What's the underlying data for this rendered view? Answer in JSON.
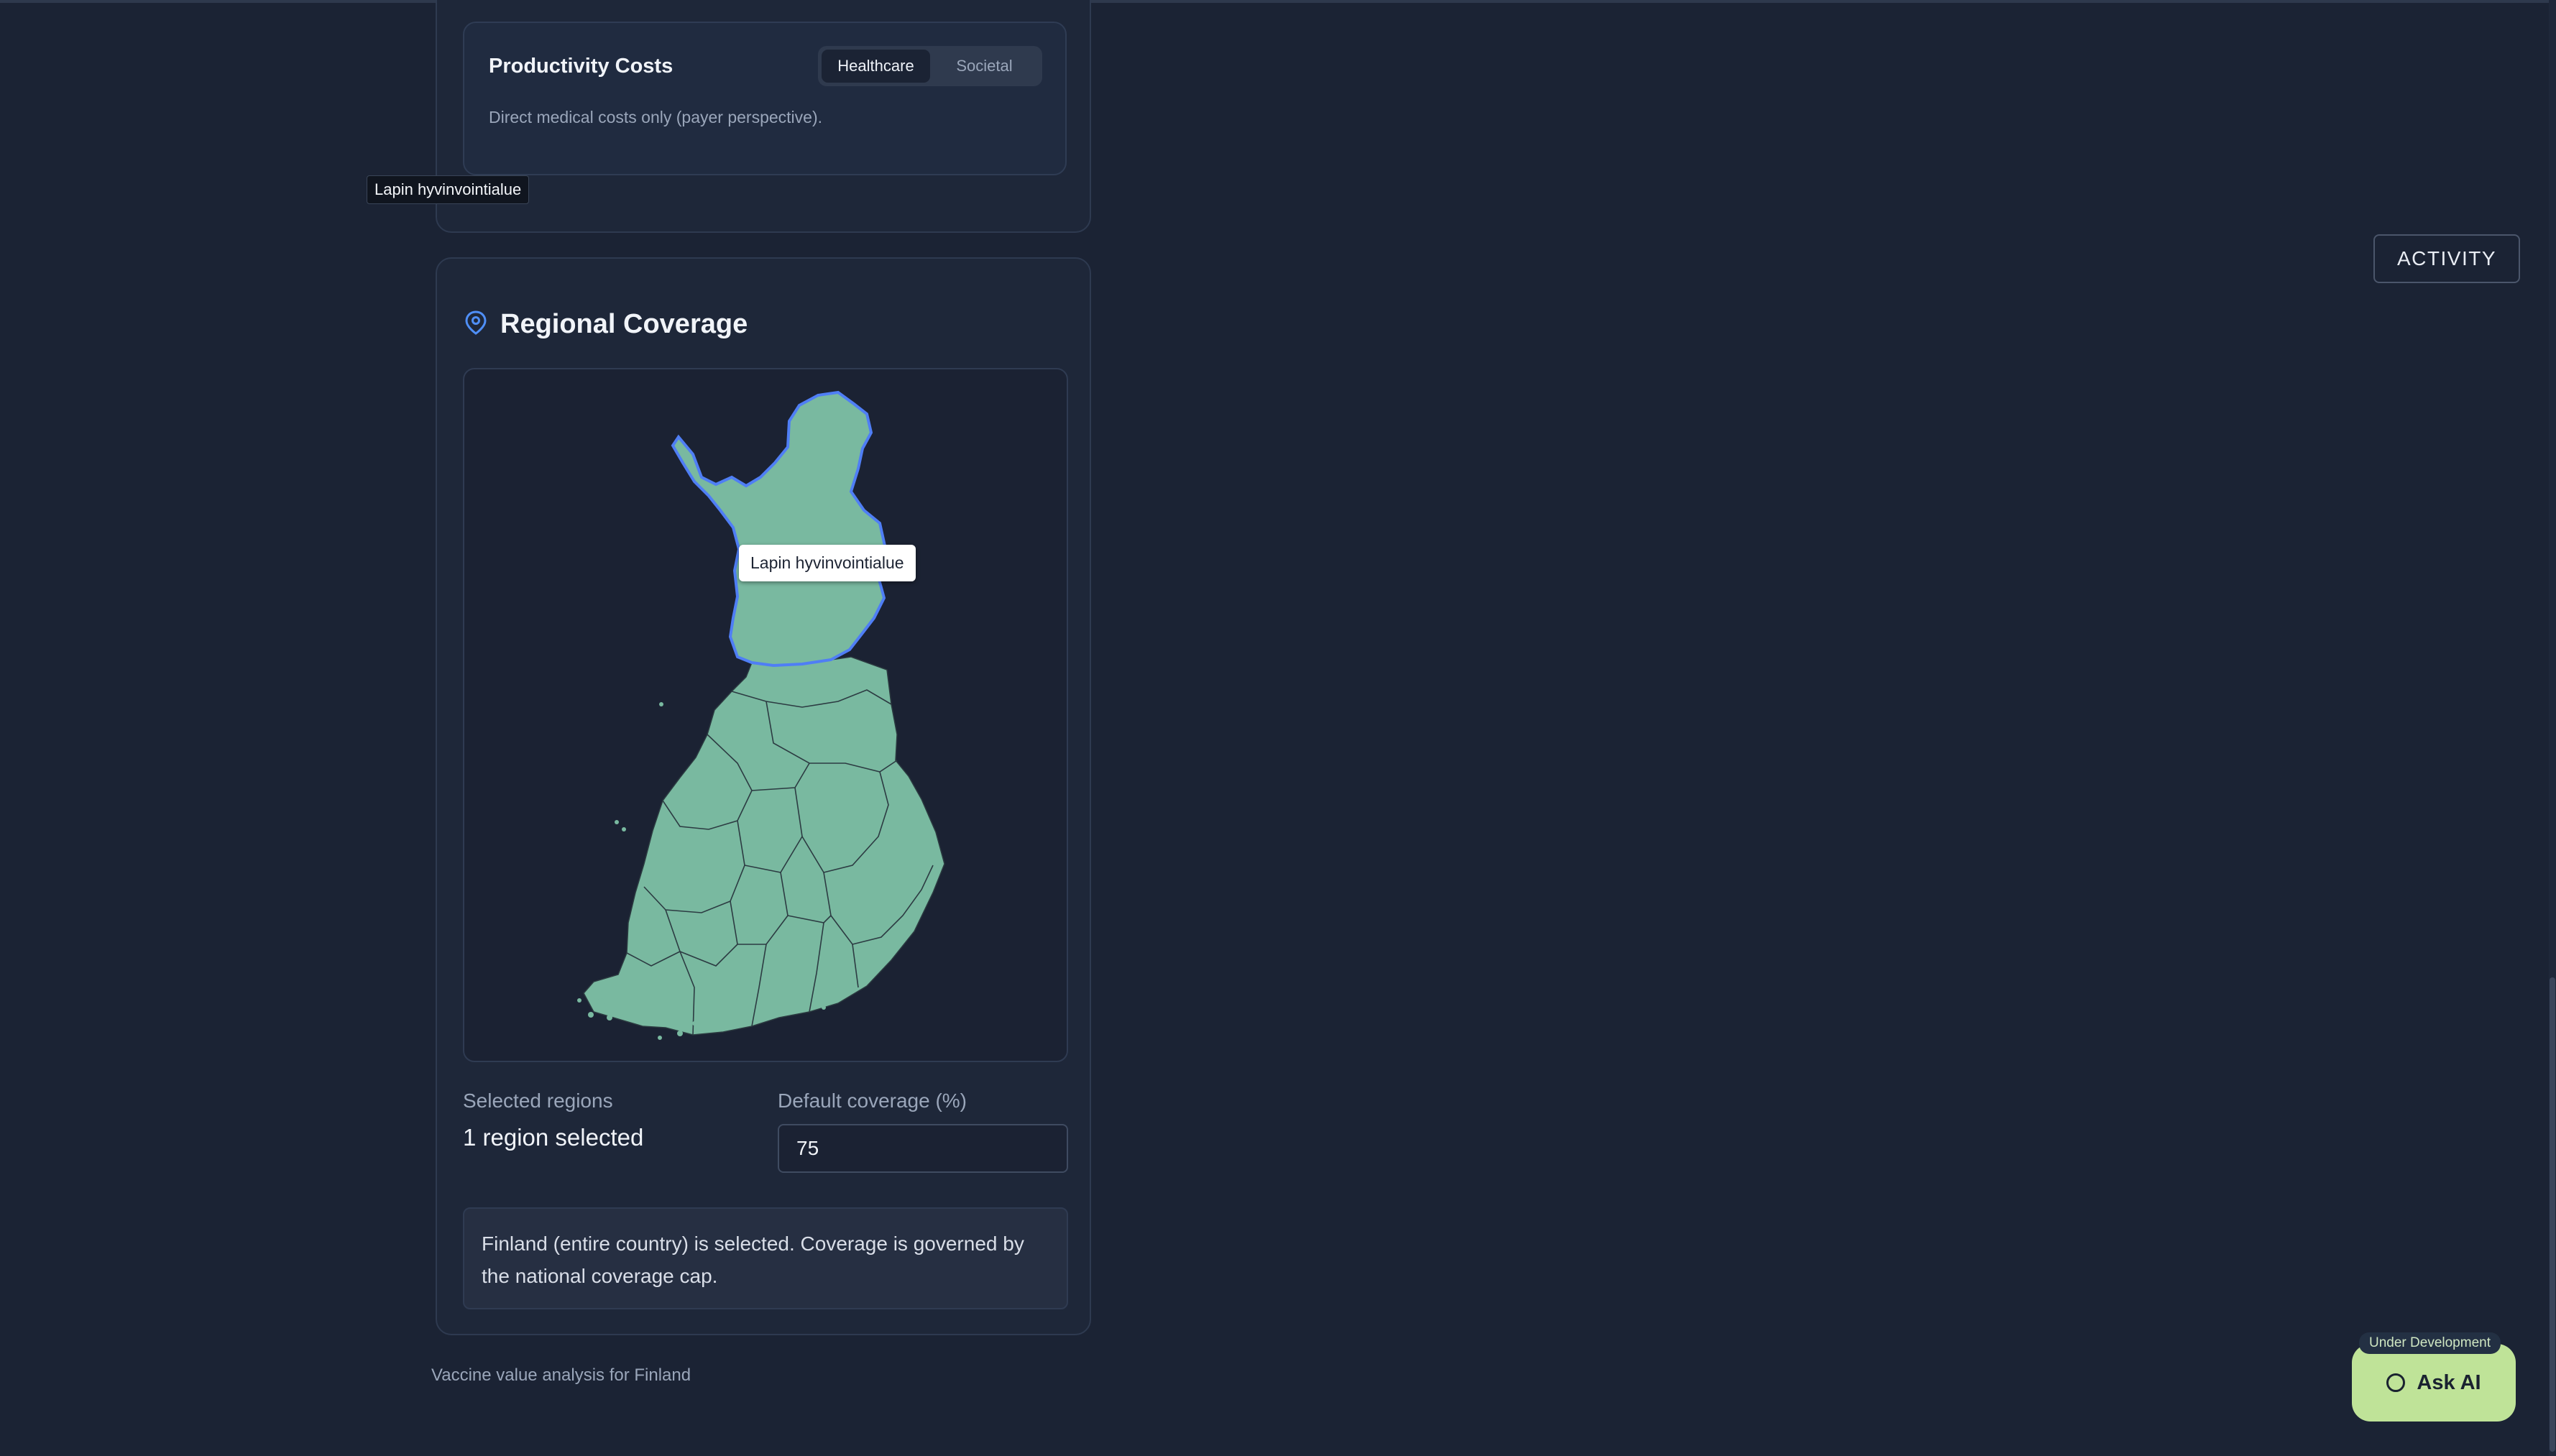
{
  "productivity": {
    "title": "Productivity Costs",
    "toggle": [
      "Healthcare",
      "Societal"
    ],
    "active": "Healthcare",
    "description": "Direct medical costs only (payer perspective)."
  },
  "floating_tooltip": "Lapin hyvinvointialue",
  "region": {
    "title": "Regional Coverage",
    "icon": "map-pin-icon",
    "map_tooltip": "Lapin hyvinvointialue",
    "selected_label": "Selected regions",
    "selected_value": "1 region selected",
    "coverage_label": "Default coverage (%)",
    "coverage_value": "75",
    "info": "Finland (entire country) is selected. Coverage is governed by the national coverage cap."
  },
  "footer": "Vaccine value analysis for Finland",
  "activity_label": "ACTIVITY",
  "ask_ai": {
    "badge": "Under Development",
    "label": "Ask AI"
  },
  "colors": {
    "background": "#1b2334",
    "map_fill": "#79b9a0",
    "map_selected_outline": "#4f7ef5",
    "ask_ai": "#bfe398"
  }
}
